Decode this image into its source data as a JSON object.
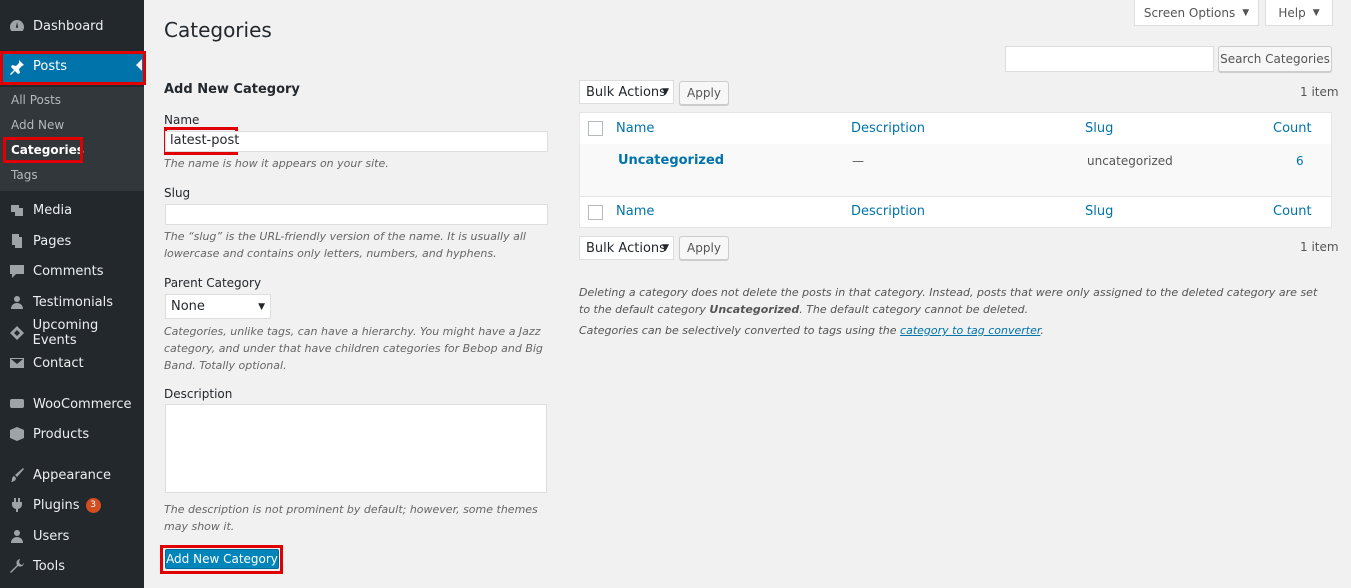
{
  "sidebar": {
    "items": [
      {
        "label": "Dashboard",
        "icon": "dashboard-icon"
      },
      {
        "label": "Posts",
        "icon": "pin-icon"
      },
      {
        "label": "Media",
        "icon": "media-icon"
      },
      {
        "label": "Pages",
        "icon": "pages-icon"
      },
      {
        "label": "Comments",
        "icon": "comments-icon"
      },
      {
        "label": "Testimonials",
        "icon": "user-icon"
      },
      {
        "label": "Upcoming Events",
        "icon": "tag-icon"
      },
      {
        "label": "Contact",
        "icon": "mail-icon"
      },
      {
        "label": "WooCommerce",
        "icon": "woo-icon"
      },
      {
        "label": "Products",
        "icon": "box-icon"
      },
      {
        "label": "Appearance",
        "icon": "brush-icon"
      },
      {
        "label": "Plugins",
        "icon": "plug-icon",
        "badge": "3"
      },
      {
        "label": "Users",
        "icon": "users-icon"
      },
      {
        "label": "Tools",
        "icon": "wrench-icon"
      }
    ],
    "submenu": [
      "All Posts",
      "Add New",
      "Categories",
      "Tags"
    ]
  },
  "header": {
    "title": "Categories",
    "screen_options": "Screen Options",
    "help": "Help",
    "search_button": "Search Categories",
    "search_value": ""
  },
  "form": {
    "title": "Add New Category",
    "name_label": "Name",
    "name_value": "latest-post",
    "name_help": "The name is how it appears on your site.",
    "slug_label": "Slug",
    "slug_help": "The “slug” is the URL-friendly version of the name. It is usually all lowercase and contains only letters, numbers, and hyphens.",
    "parent_label": "Parent Category",
    "parent_value": "None",
    "parent_help": "Categories, unlike tags, can have a hierarchy. You might have a Jazz category, and under that have children categories for Bebop and Big Band. Totally optional.",
    "description_label": "Description",
    "description_help": "The description is not prominent by default; however, some themes may show it.",
    "submit": "Add New Category"
  },
  "table": {
    "bulk_actions": "Bulk Actions",
    "apply": "Apply",
    "item_count": "1 item",
    "columns": [
      "Name",
      "Description",
      "Slug",
      "Count"
    ],
    "rows": [
      {
        "name": "Uncategorized",
        "description": "—",
        "slug": "uncategorized",
        "count": "6"
      }
    ]
  },
  "notes": {
    "delete_note_a": "Deleting a category does not delete the posts in that category. Instead, posts that were only assigned to the deleted category are set to the default category ",
    "delete_note_bold": "Uncategorized",
    "delete_note_b": ". The default category cannot be deleted.",
    "convert_note": "Categories can be selectively converted to tags using the ",
    "convert_link": "category to tag converter",
    "convert_end": "."
  },
  "colors": {
    "sidebar_bg": "#23282d",
    "accent": "#0073aa",
    "highlight": "#e00000",
    "badge": "#d54e21"
  }
}
